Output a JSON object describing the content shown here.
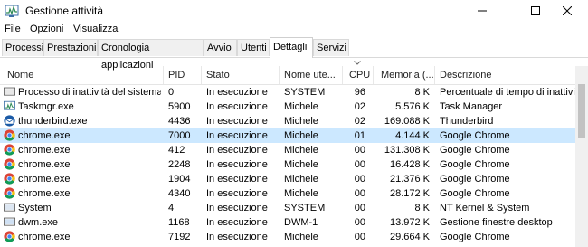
{
  "window": {
    "title": "Gestione attività",
    "minimize_glyph": "—",
    "maximize_glyph": "☐",
    "close_glyph": "✕"
  },
  "menu": [
    "File",
    "Opzioni",
    "Visualizza"
  ],
  "tabs": [
    {
      "label": "Processi",
      "active": false
    },
    {
      "label": "Prestazioni",
      "active": false
    },
    {
      "label": "Cronologia applicazioni",
      "active": false
    },
    {
      "label": "Avvio",
      "active": false
    },
    {
      "label": "Utenti",
      "active": false
    },
    {
      "label": "Dettagli",
      "active": true
    },
    {
      "label": "Servizi",
      "active": false
    }
  ],
  "columns": [
    "Nome",
    "PID",
    "Stato",
    "Nome ute...",
    "CPU",
    "Memoria (...",
    "Descrizione"
  ],
  "rows": [
    {
      "icon": "system-idle-icon",
      "name": "Processo di inattività del sistema",
      "pid": "0",
      "status": "In esecuzione",
      "user": "SYSTEM",
      "cpu": "96",
      "memory": "8 K",
      "description": "Percentuale di tempo di inattività"
    },
    {
      "icon": "taskmgr-icon",
      "name": "Taskmgr.exe",
      "pid": "5900",
      "status": "In esecuzione",
      "user": "Michele",
      "cpu": "02",
      "memory": "5.576 K",
      "description": "Task Manager"
    },
    {
      "icon": "thunderbird-icon",
      "name": "thunderbird.exe",
      "pid": "4436",
      "status": "In esecuzione",
      "user": "Michele",
      "cpu": "02",
      "memory": "169.088 K",
      "description": "Thunderbird"
    },
    {
      "icon": "chrome-icon",
      "name": "chrome.exe",
      "pid": "7000",
      "status": "In esecuzione",
      "user": "Michele",
      "cpu": "01",
      "memory": "4.144 K",
      "description": "Google Chrome",
      "selected": true
    },
    {
      "icon": "chrome-icon",
      "name": "chrome.exe",
      "pid": "412",
      "status": "In esecuzione",
      "user": "Michele",
      "cpu": "00",
      "memory": "131.308 K",
      "description": "Google Chrome"
    },
    {
      "icon": "chrome-icon",
      "name": "chrome.exe",
      "pid": "2248",
      "status": "In esecuzione",
      "user": "Michele",
      "cpu": "00",
      "memory": "16.428 K",
      "description": "Google Chrome"
    },
    {
      "icon": "chrome-icon",
      "name": "chrome.exe",
      "pid": "1904",
      "status": "In esecuzione",
      "user": "Michele",
      "cpu": "00",
      "memory": "21.376 K",
      "description": "Google Chrome"
    },
    {
      "icon": "chrome-icon",
      "name": "chrome.exe",
      "pid": "4340",
      "status": "In esecuzione",
      "user": "Michele",
      "cpu": "00",
      "memory": "28.172 K",
      "description": "Google Chrome"
    },
    {
      "icon": "system-icon",
      "name": "System",
      "pid": "4",
      "status": "In esecuzione",
      "user": "SYSTEM",
      "cpu": "00",
      "memory": "8 K",
      "description": "NT Kernel & System"
    },
    {
      "icon": "dwm-icon",
      "name": "dwm.exe",
      "pid": "1168",
      "status": "In esecuzione",
      "user": "DWM-1",
      "cpu": "00",
      "memory": "13.972 K",
      "description": "Gestione finestre desktop"
    },
    {
      "icon": "chrome-icon",
      "name": "chrome.exe",
      "pid": "7192",
      "status": "In esecuzione",
      "user": "Michele",
      "cpu": "00",
      "memory": "29.664 K",
      "description": "Google Chrome"
    }
  ],
  "colors": {
    "selection": "#cce8ff",
    "chrome_red": "#db4437",
    "chrome_yellow": "#f4c20d",
    "chrome_green": "#0f9d58",
    "chrome_blue": "#4285f4"
  }
}
